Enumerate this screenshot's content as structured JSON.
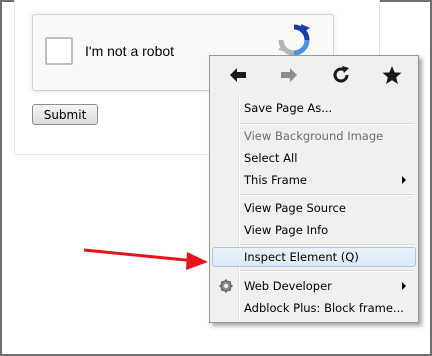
{
  "page": {
    "captcha": {
      "label": "I'm not a robot"
    },
    "submit_label": "Submit"
  },
  "context_menu": {
    "nav": {
      "back_icon": "back-arrow-icon",
      "forward_icon": "forward-arrow-icon",
      "reload_icon": "reload-icon",
      "bookmark_icon": "star-icon",
      "forward_disabled": true
    },
    "items": {
      "save_page_as": {
        "label": "Save Page As..."
      },
      "view_background_image": {
        "label": "View Background Image",
        "disabled": true
      },
      "select_all": {
        "label": "Select All"
      },
      "this_frame": {
        "label": "This Frame",
        "submenu": true
      },
      "view_page_source": {
        "label": "View Page Source"
      },
      "view_page_info": {
        "label": "View Page Info"
      },
      "inspect_element": {
        "label": "Inspect Element (Q)",
        "highlighted": true
      },
      "web_developer": {
        "label": "Web Developer",
        "submenu": true,
        "icon": "gear-icon"
      },
      "adblock_block_frame": {
        "label": "Adblock Plus: Block frame..."
      }
    }
  },
  "colors": {
    "annotation_arrow": "#e8131b",
    "highlight_border": "#a8c7ec",
    "menu_bg": "#f0f0f0"
  }
}
